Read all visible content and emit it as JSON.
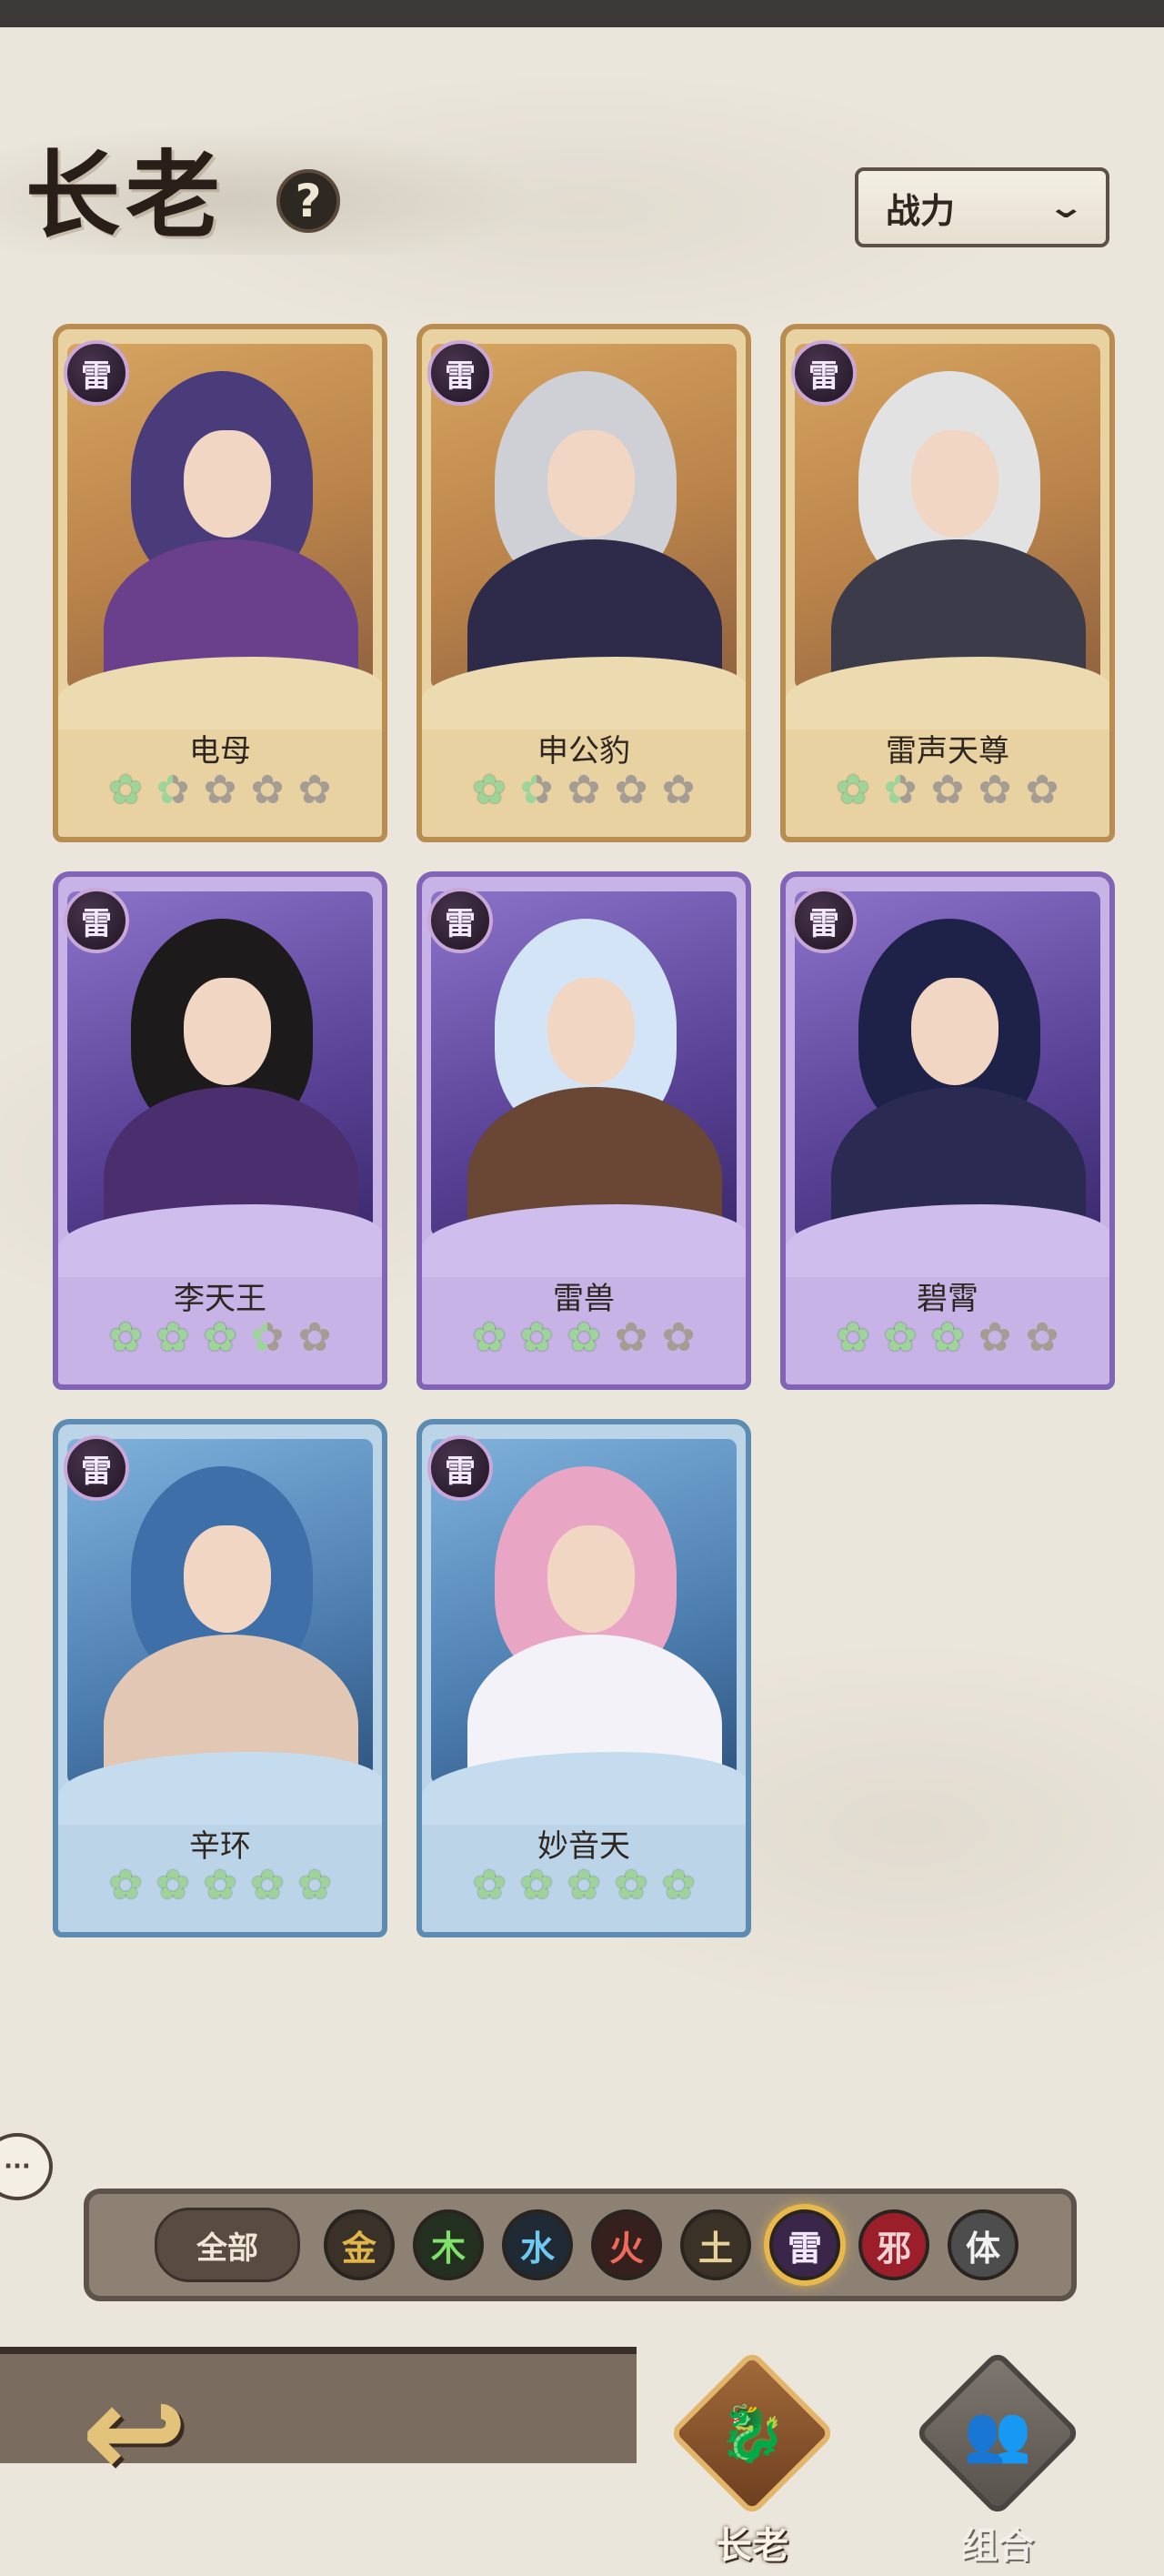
{
  "header": {
    "title": "长老",
    "help_icon": "?",
    "sort_label": "战力"
  },
  "heroes": [
    {
      "name": "电母",
      "element": "雷",
      "frame": "gold",
      "stars": 1.5,
      "hair": "#4a3c7a",
      "outfit": "#6a3f8c"
    },
    {
      "name": "申公豹",
      "element": "雷",
      "frame": "gold",
      "stars": 1.5,
      "hair": "#cfcfd6",
      "outfit": "#2d2a4a"
    },
    {
      "name": "雷声天尊",
      "element": "雷",
      "frame": "gold",
      "stars": 1.5,
      "hair": "#e2e2e2",
      "outfit": "#3b3b4a"
    },
    {
      "name": "李天王",
      "element": "雷",
      "frame": "purple",
      "stars": 3.5,
      "hair": "#1d1a1c",
      "outfit": "#4a2e6e"
    },
    {
      "name": "雷兽",
      "element": "雷",
      "frame": "purple",
      "stars": 3,
      "hair": "#d2e4f6",
      "outfit": "#6a4634"
    },
    {
      "name": "碧霄",
      "element": "雷",
      "frame": "purple",
      "stars": 3,
      "hair": "#1e2148",
      "outfit": "#2a2a52"
    },
    {
      "name": "辛环",
      "element": "雷",
      "frame": "blue",
      "stars": 5,
      "hair": "#3e6fa8",
      "outfit": "#e2c8b4"
    },
    {
      "name": "妙音天",
      "element": "雷",
      "frame": "blue",
      "stars": 5,
      "hair": "#e8a6c4",
      "outfit": "#f2f2f8"
    }
  ],
  "filters": {
    "all_label": "全部",
    "elements": [
      {
        "label": "金",
        "color": "#e0b64a",
        "bg": "#3a3128",
        "icon": "gold-element-icon"
      },
      {
        "label": "木",
        "color": "#7fe06a",
        "bg": "#24301f",
        "icon": "wood-element-icon"
      },
      {
        "label": "水",
        "color": "#6fc8f2",
        "bg": "#1f2a35",
        "icon": "water-element-icon"
      },
      {
        "label": "火",
        "color": "#f06a5a",
        "bg": "#35201d",
        "icon": "fire-element-icon"
      },
      {
        "label": "土",
        "color": "#e8d29a",
        "bg": "#3a3226",
        "icon": "earth-element-icon"
      },
      {
        "label": "雷",
        "color": "#f4e8ff",
        "bg": "#3a2648",
        "icon": "thunder-element-icon",
        "selected": true
      },
      {
        "label": "邪",
        "color": "#f2d2d2",
        "bg": "#9a1f2a",
        "icon": "evil-element-icon"
      },
      {
        "label": "体",
        "color": "#f2f2f2",
        "bg": "#4d4d4d",
        "icon": "body-element-icon"
      }
    ]
  },
  "nav": {
    "tab_elder": "长老",
    "tab_combo": "组合"
  }
}
